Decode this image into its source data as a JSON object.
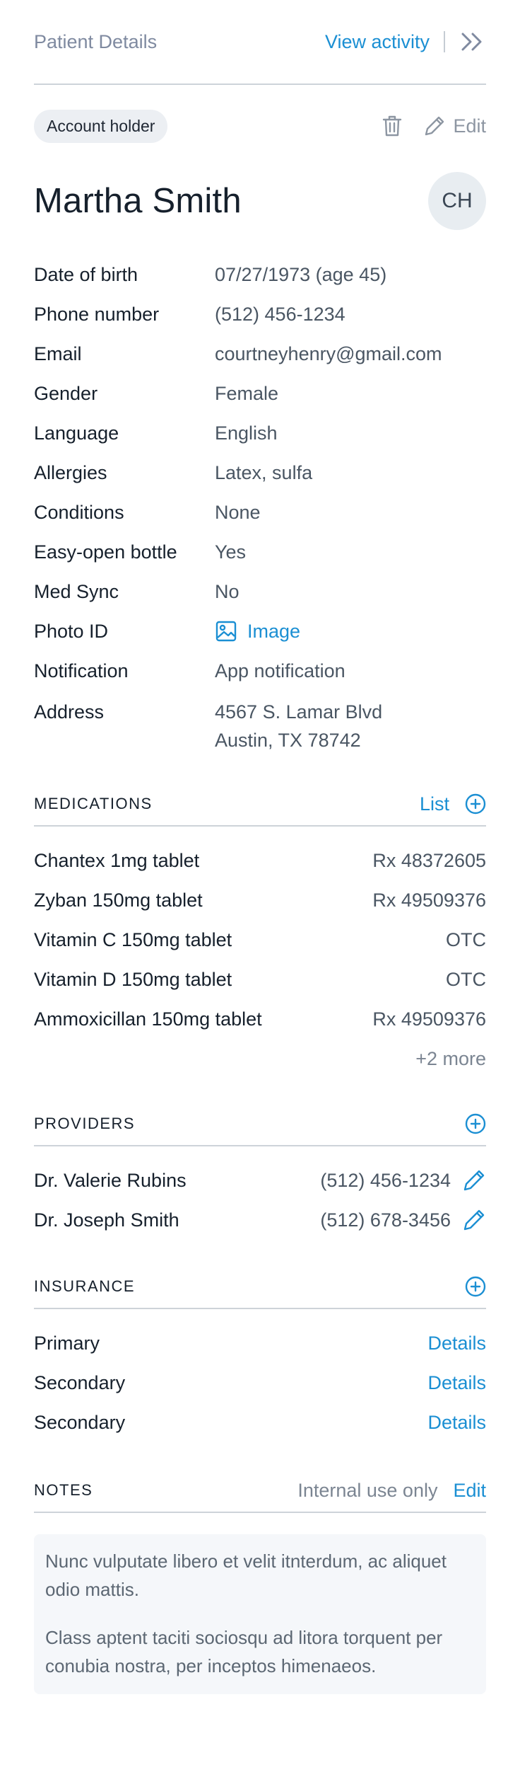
{
  "header": {
    "title": "Patient Details",
    "view_activity": "View activity",
    "collapse_icon": "double-chevron-right-icon"
  },
  "patient": {
    "badge": "Account holder",
    "edit_label": "Edit",
    "name": "Martha Smith",
    "initials": "CH"
  },
  "details": [
    {
      "label": "Date of birth",
      "value": "07/27/1973 (age 45)"
    },
    {
      "label": "Phone number",
      "value": "(512) 456-1234"
    },
    {
      "label": "Email",
      "value": "courtneyhenry@gmail.com"
    },
    {
      "label": "Gender",
      "value": "Female"
    },
    {
      "label": "Language",
      "value": "English"
    },
    {
      "label": "Allergies",
      "value": "Latex, sulfa"
    },
    {
      "label": "Conditions",
      "value": "None"
    },
    {
      "label": "Easy-open bottle",
      "value": "Yes"
    },
    {
      "label": "Med Sync",
      "value": "No"
    },
    {
      "label": "Photo ID",
      "value": "Image"
    },
    {
      "label": "Notification",
      "value": "App notification"
    },
    {
      "label": "Address",
      "value_line1": "4567 S. Lamar Blvd",
      "value_line2": "Austin, TX 78742"
    }
  ],
  "medications": {
    "heading": "MEDICATIONS",
    "list_label": "List",
    "items": [
      {
        "name": "Chantex 1mg tablet",
        "rx": "Rx 48372605"
      },
      {
        "name": "Zyban 150mg tablet",
        "rx": "Rx 49509376"
      },
      {
        "name": "Vitamin C 150mg tablet",
        "rx": "OTC"
      },
      {
        "name": "Vitamin D 150mg tablet",
        "rx": "OTC"
      },
      {
        "name": "Ammoxicillan 150mg tablet",
        "rx": "Rx 49509376"
      }
    ],
    "more": "+2 more"
  },
  "providers": {
    "heading": "PROVIDERS",
    "items": [
      {
        "name": "Dr. Valerie Rubins",
        "phone": "(512) 456-1234"
      },
      {
        "name": "Dr. Joseph Smith",
        "phone": "(512) 678-3456"
      }
    ]
  },
  "insurance": {
    "heading": "INSURANCE",
    "items": [
      {
        "label": "Primary",
        "link": "Details"
      },
      {
        "label": "Secondary",
        "link": "Details"
      },
      {
        "label": "Secondary",
        "link": "Details"
      }
    ]
  },
  "notes": {
    "heading": "NOTES",
    "internal": "Internal use only",
    "edit_label": "Edit",
    "paragraphs": [
      "Nunc vulputate libero et velit itnterdum, ac aliquet odio mattis.",
      "Class aptent taciti sociosqu ad litora torquent per conubia nostra, per inceptos himenaeos."
    ]
  },
  "colors": {
    "accent": "#1b8fd3",
    "divider": "#cdd3d9"
  }
}
